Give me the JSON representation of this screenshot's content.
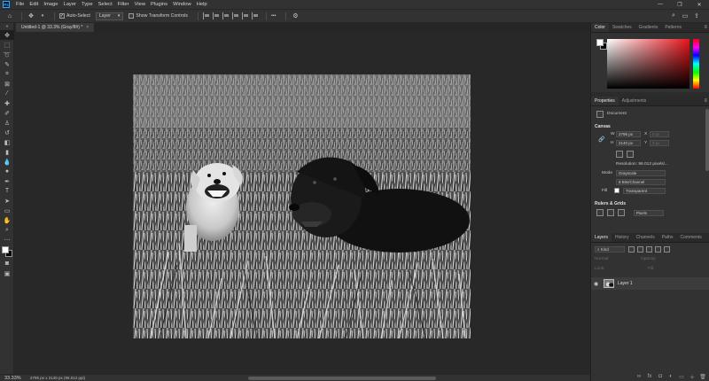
{
  "app": {
    "logo": "Ps",
    "menu": [
      "File",
      "Edit",
      "Image",
      "Layer",
      "Type",
      "Select",
      "Filter",
      "View",
      "Plugins",
      "Window",
      "Help"
    ],
    "window_controls": [
      "—",
      "❐",
      "✕"
    ]
  },
  "options_bar": {
    "auto_select_label": "Auto-Select",
    "auto_select_target": "Layer",
    "transform_label": "Show Transform Controls",
    "more_label": "•••"
  },
  "document": {
    "tab_title": "Untitled-1 @ 33.3% (Gray/8#) *",
    "tab_close": "×"
  },
  "status": {
    "zoom": "33.33%",
    "doc_info": "2795 px x 2140 px (96.012 ppi)"
  },
  "color_panel": {
    "tabs": [
      "Color",
      "Swatches",
      "Gradients",
      "Patterns"
    ],
    "colors": {
      "foreground": "#ffffff",
      "background": "#000000",
      "field_hue": "#e8141b"
    }
  },
  "properties_panel": {
    "tabs": [
      "Properties",
      "Adjustments"
    ],
    "doc_label": "Document",
    "canvas_section": "Canvas",
    "width_label": "W",
    "width_value": "2795 px",
    "height_label": "H",
    "height_value": "2140 px",
    "x_label": "X",
    "x_value": "0 px",
    "y_label": "Y",
    "y_value": "0 px",
    "resolution_label": "Resolution: 96.012 pixels/...",
    "mode_label": "Mode",
    "mode_value": "Grayscale",
    "bit_value": "8 Bits/Channel",
    "fill_label": "Fill",
    "fill_value": "Transparent",
    "rulers_section": "Rulers & Grids",
    "units_value": "Pixels"
  },
  "layers_panel": {
    "tabs": [
      "Layers",
      "History",
      "Channels",
      "Paths",
      "Comments"
    ],
    "filter_kind": "Kind",
    "blend_mode": "Normal",
    "opacity_label": "Opacity:",
    "lock_label": "Lock:",
    "fill_label": "Fill:",
    "layers": [
      {
        "name": "Layer 1",
        "visible": true
      }
    ]
  }
}
